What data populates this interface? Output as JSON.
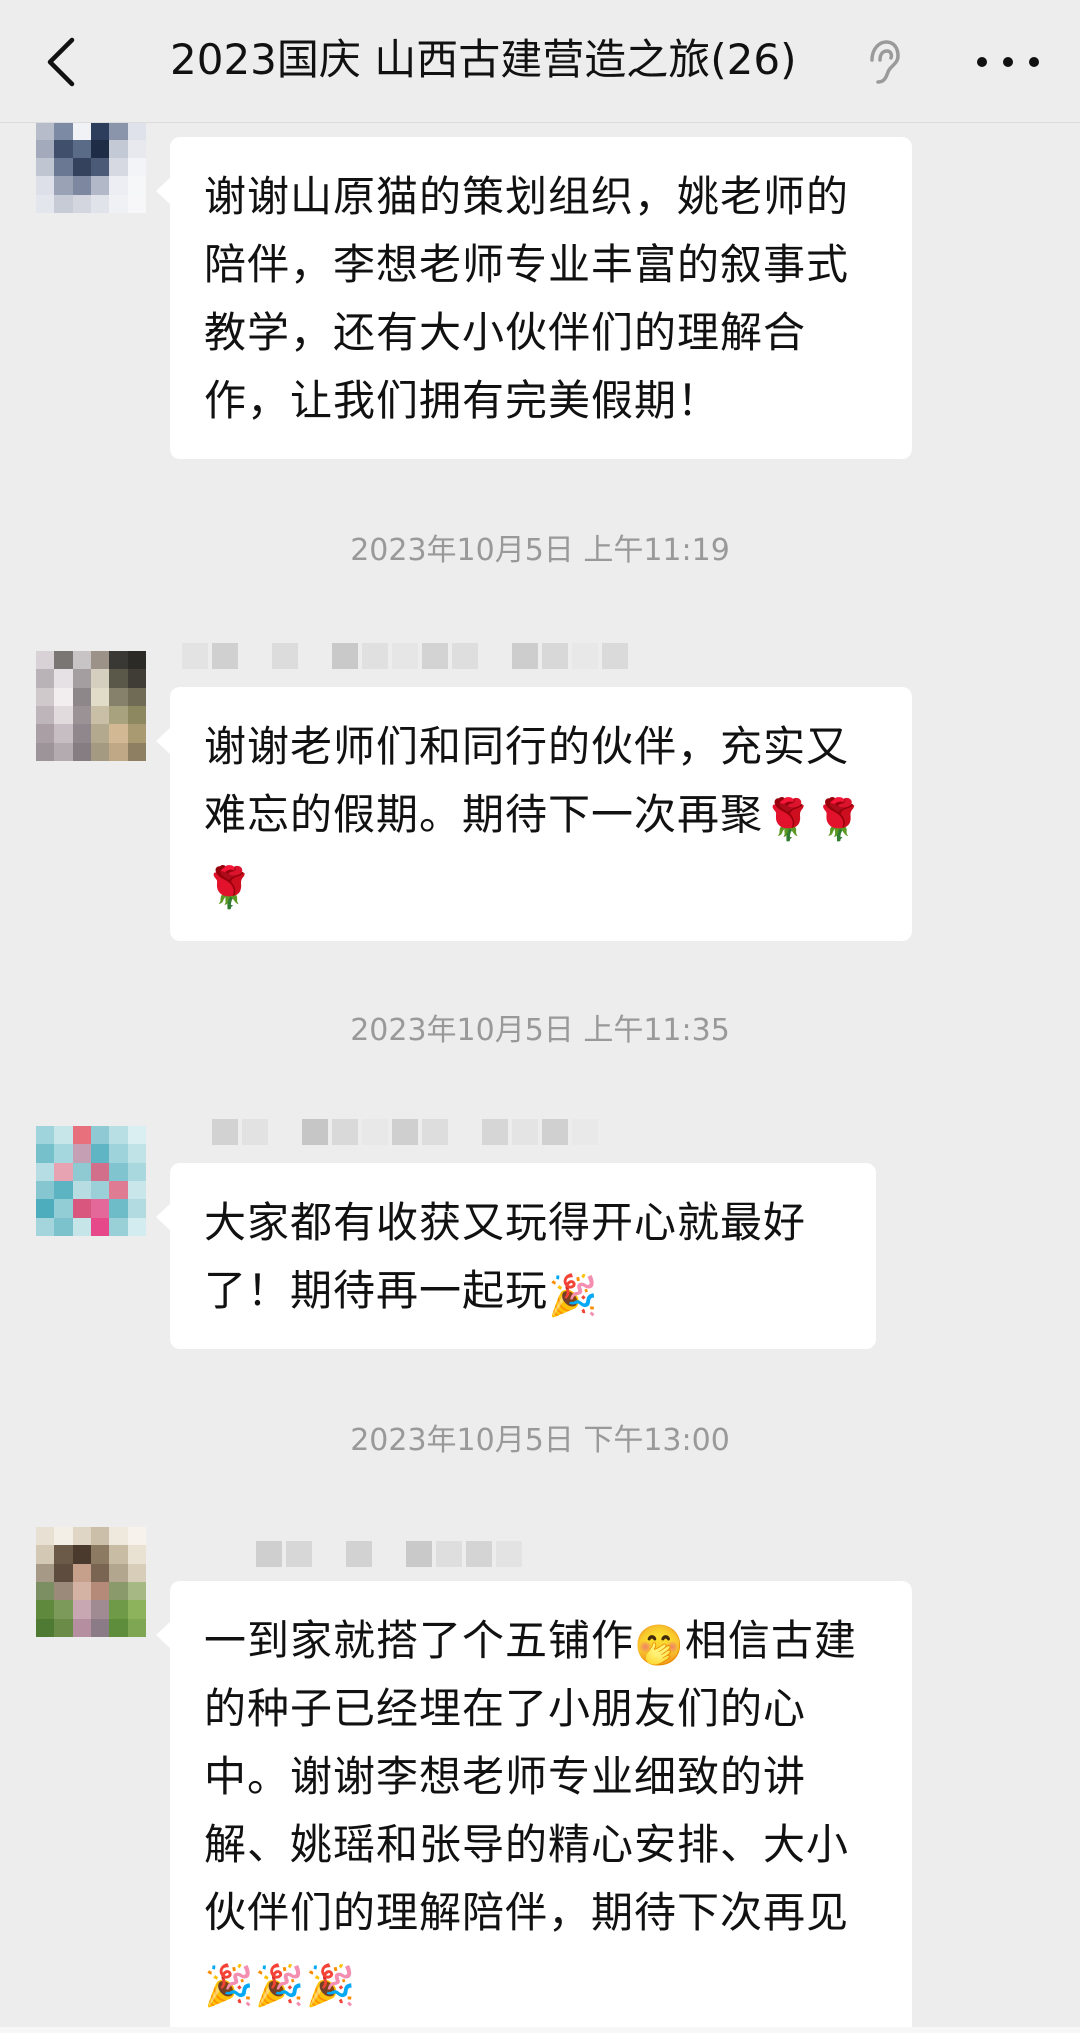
{
  "header": {
    "title": "2023国庆 山西古建营造之旅(26)",
    "back_icon": "chevron-left-icon",
    "mute_icon": "ear-icon",
    "more_icon": "more-dots-icon"
  },
  "messages": [
    {
      "text": "谢谢山原猫的策划组织，姚老师的陪伴，李想老师专业丰富的叙事式教学，还有大小伙伴们的理解合作，让我们拥有完美假期！",
      "emoji_tail": ""
    },
    {
      "timestamp": "2023年10月5日 上午11:19",
      "text": "谢谢老师们和同行的伙伴，充实又难忘的假期。期待下一次再聚",
      "emoji_tail": "🌹🌹🌹"
    },
    {
      "timestamp": "2023年10月5日 上午11:35",
      "text": "大家都有收获又玩得开心就最好了！期待再一起玩",
      "emoji_tail": "🎉"
    },
    {
      "timestamp": "2023年10月5日 下午13:00",
      "text_part1": "一到家就搭了个五铺作",
      "mid_emoji": "🤭",
      "text_part2": "相信古建的种子已经埋在了小朋友们的心中。谢谢李想老师专业细致的讲解、姚瑶和张导的精心安排、大小伙伴们的理解陪伴，期待下次再见",
      "emoji_tail": "🎉🎉🎉"
    }
  ],
  "colors": {
    "background": "#ededed",
    "bubble": "#ffffff",
    "timestamp": "#999999"
  }
}
